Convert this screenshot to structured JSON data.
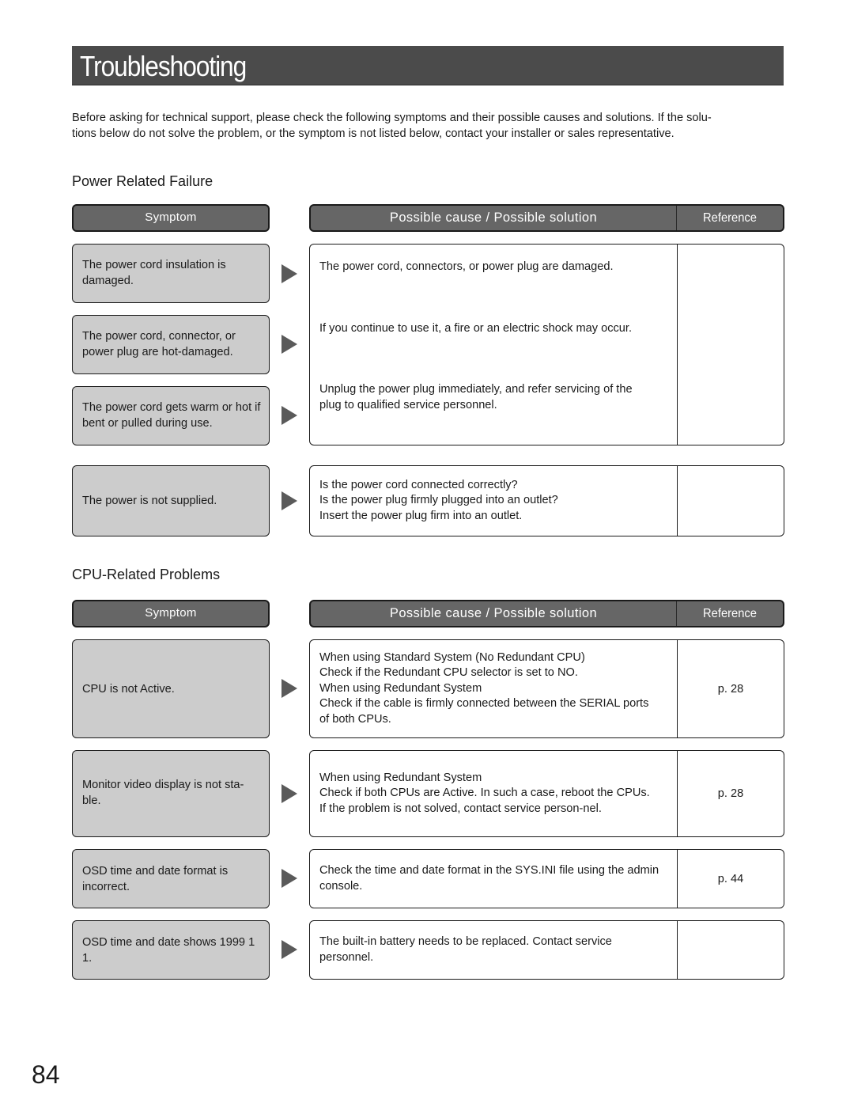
{
  "title": "Troubleshooting",
  "intro": "Before asking for technical support, please check the following symptoms and their possible causes and solutions. If the solu-tions below do not solve the problem, or the symptom is not listed below, contact your installer or sales representative.",
  "intro_lines": [
    "Before asking for technical support, please check the following symptoms and their possible causes and solutions. If the solu-",
    "tions below do not solve the problem, or the symptom is not listed below, contact your installer or sales representative."
  ],
  "headers": {
    "symptom": "Symptom",
    "solution": "Possible cause / Possible solution",
    "reference": "Reference"
  },
  "sections": [
    {
      "title": "Power Related Failure",
      "symptoms": [
        "The power cord insulation is damaged.",
        "The power cord, connector, or power plug are hot-damaged.",
        "The power cord gets warm or hot if bent or pulled during use.",
        "The power is not supplied."
      ],
      "solutions": [
        {
          "paragraphs": [
            "The power cord, connectors, or power plug are damaged.",
            "If you continue to use it, a fire or an electric shock may occur.",
            "Unplug the power plug immediately, and refer servicing of the plug to qualified service personnel."
          ],
          "reference": ""
        },
        {
          "lines": [
            "Is the power cord connected correctly?",
            "Is the power plug firmly plugged into an outlet?",
            "Insert the power plug firm into an outlet."
          ],
          "reference": ""
        }
      ]
    },
    {
      "title": "CPU-Related Problems",
      "rows": [
        {
          "symptom": "CPU is not Active.",
          "lines": [
            "When using Standard System (No Redundant CPU)",
            "Check if the Redundant CPU selector is set to NO.",
            "When using Redundant System",
            "Check if the cable is firmly connected between the SERIAL ports of both CPUs."
          ],
          "reference": "p. 28"
        },
        {
          "symptom": "Monitor video display is not sta-ble.",
          "lines": [
            "When using Redundant System",
            "Check if both CPUs are Active. In such a case, reboot the CPUs. If the problem is not solved, contact service person-nel."
          ],
          "reference": "p. 28"
        },
        {
          "symptom": "OSD time and date format is incorrect.",
          "lines": [
            "Check the time and date format in the SYS.INI file using the admin console."
          ],
          "reference": "p. 44"
        },
        {
          "symptom": "OSD time and date shows 1999 1 1.",
          "lines": [
            "The built-in battery needs to be replaced. Contact service personnel."
          ],
          "reference": ""
        }
      ]
    }
  ],
  "page_number": "84"
}
